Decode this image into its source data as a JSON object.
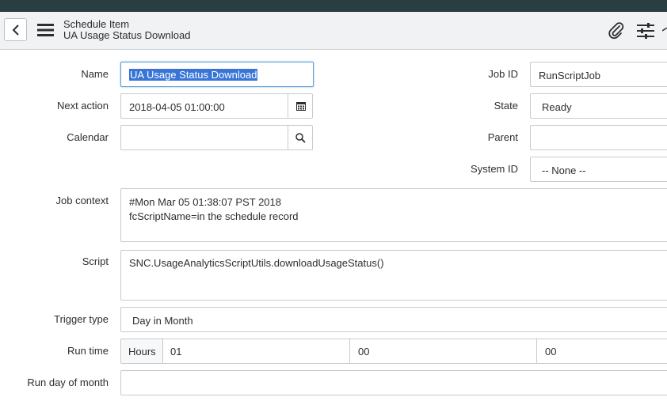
{
  "header": {
    "title": "Schedule Item",
    "subtitle": "UA Usage Status Download"
  },
  "form": {
    "name": {
      "label": "Name",
      "value": "UA Usage Status Download"
    },
    "next_action": {
      "label": "Next action",
      "value": "2018-04-05 01:00:00"
    },
    "calendar": {
      "label": "Calendar",
      "value": ""
    },
    "job_id": {
      "label": "Job ID",
      "value": "RunScriptJob"
    },
    "state": {
      "label": "State",
      "value": "Ready"
    },
    "parent": {
      "label": "Parent",
      "value": ""
    },
    "system_id": {
      "label": "System ID",
      "value": "-- None --"
    },
    "job_context": {
      "label": "Job context",
      "lines": [
        "#Mon Mar 05 01:38:07 PST 2018",
        "fcScriptName=in the schedule record"
      ]
    },
    "script": {
      "label": "Script",
      "value": "SNC.UsageAnalyticsScriptUtils.downloadUsageStatus()"
    },
    "trigger_type": {
      "label": "Trigger type",
      "value": "Day in Month"
    },
    "run_time": {
      "label": "Run time",
      "unit": "Hours",
      "hours": "01",
      "minutes": "00",
      "seconds": "00"
    },
    "run_day_of_month": {
      "label": "Run day of month",
      "value": ""
    }
  },
  "colors": {
    "topbar": "#293e40",
    "header_bg": "#f1f2f3",
    "selection": "#3875d7",
    "focus": "#5e9ed6"
  },
  "icons": [
    "chevron-left-icon",
    "hamburger-menu-icon",
    "paperclip-icon",
    "sliders-icon",
    "calendar-icon",
    "search-icon"
  ]
}
